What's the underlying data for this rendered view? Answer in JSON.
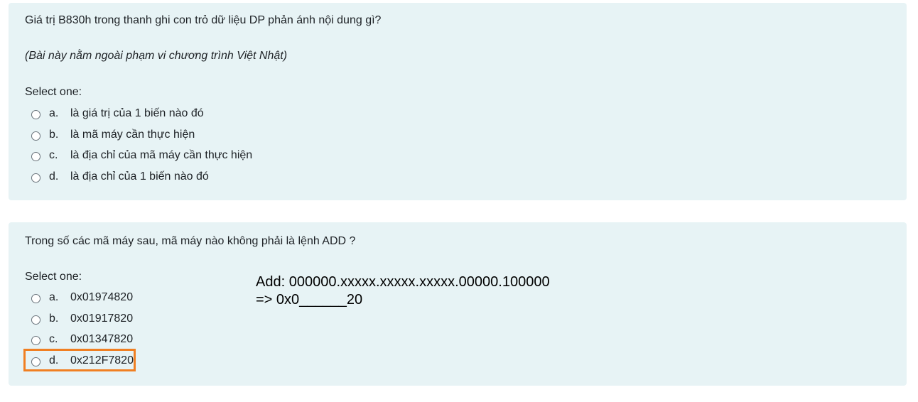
{
  "questions": [
    {
      "text": "Giá trị B830h trong thanh ghi con trỏ dữ liệu DP phản ánh nội dung gì?",
      "note": "(Bài này nằm ngoài phạm vi chương trình Việt Nhật)",
      "prompt": "Select one:",
      "answers": [
        {
          "letter": "a.",
          "text": "là giá trị của 1 biến nào đó"
        },
        {
          "letter": "b.",
          "text": "là mã máy cần thực hiện"
        },
        {
          "letter": "c.",
          "text": "là địa chỉ của mã máy cần thực hiện"
        },
        {
          "letter": "d.",
          "text": "là địa chỉ của 1 biến nào đó"
        }
      ]
    },
    {
      "text": "Trong số các mã máy sau, mã máy nào không phải là lệnh ADD ?",
      "prompt": "Select one:",
      "answers": [
        {
          "letter": "a.",
          "text": "0x01974820"
        },
        {
          "letter": "b.",
          "text": "0x01917820"
        },
        {
          "letter": "c.",
          "text": "0x01347820"
        },
        {
          "letter": "d.",
          "text": "0x212F7820"
        }
      ],
      "annotation": {
        "line1": "Add: 000000.xxxxx.xxxxx.xxxxx.00000.100000",
        "line2": "=> 0x0______20"
      }
    }
  ],
  "colors": {
    "card_background": "#e7f3f5",
    "highlight": "#f07f22",
    "text": "#1d2125"
  }
}
